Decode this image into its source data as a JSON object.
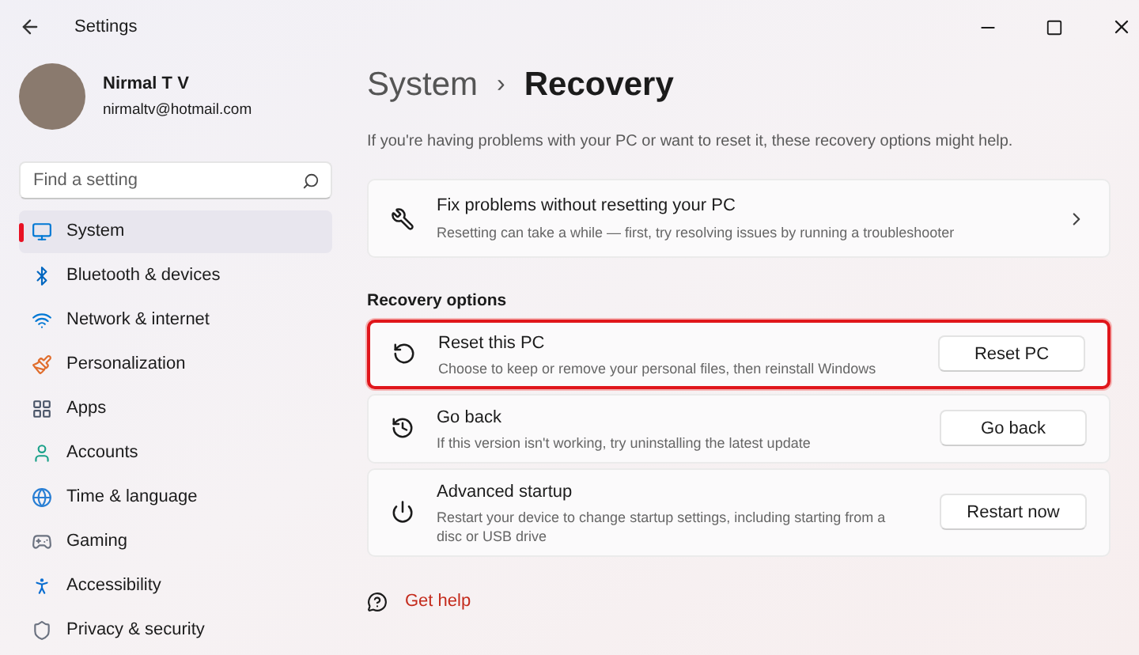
{
  "window": {
    "title": "Settings"
  },
  "account": {
    "name": "Nirmal T V",
    "email": "nirmaltv@hotmail.com"
  },
  "search": {
    "placeholder": "Find a setting"
  },
  "sidebar": {
    "items": [
      {
        "kind": "system",
        "label": "System",
        "selected": true
      },
      {
        "kind": "bluetooth",
        "label": "Bluetooth & devices",
        "selected": false
      },
      {
        "kind": "network",
        "label": "Network & internet",
        "selected": false
      },
      {
        "kind": "personalization",
        "label": "Personalization",
        "selected": false
      },
      {
        "kind": "apps",
        "label": "Apps",
        "selected": false
      },
      {
        "kind": "accounts",
        "label": "Accounts",
        "selected": false
      },
      {
        "kind": "time",
        "label": "Time & language",
        "selected": false
      },
      {
        "kind": "gaming",
        "label": "Gaming",
        "selected": false
      },
      {
        "kind": "accessibility",
        "label": "Accessibility",
        "selected": false
      },
      {
        "kind": "privacy",
        "label": "Privacy & security",
        "selected": false
      }
    ]
  },
  "breadcrumb": {
    "parent": "System",
    "separator": "›",
    "current": "Recovery"
  },
  "intro": "If you're having problems with your PC or want to reset it, these recovery options might help.",
  "fix_card": {
    "title": "Fix problems without resetting your PC",
    "description": "Resetting can take a while — first, try resolving issues by running a troubleshooter"
  },
  "section_title": "Recovery options",
  "options": [
    {
      "kind": "reset",
      "title": "Reset this PC",
      "description": "Choose to keep or remove your personal files, then reinstall Windows",
      "button": "Reset PC",
      "highlighted": true
    },
    {
      "kind": "goback",
      "title": "Go back",
      "description": "If this version isn't working, try uninstalling the latest update",
      "button": "Go back",
      "highlighted": false
    },
    {
      "kind": "advanced",
      "title": "Advanced startup",
      "description": "Restart your device to change startup settings, including starting from a disc or USB drive",
      "button": "Restart now",
      "highlighted": false
    }
  ],
  "help_link": "Get help"
}
